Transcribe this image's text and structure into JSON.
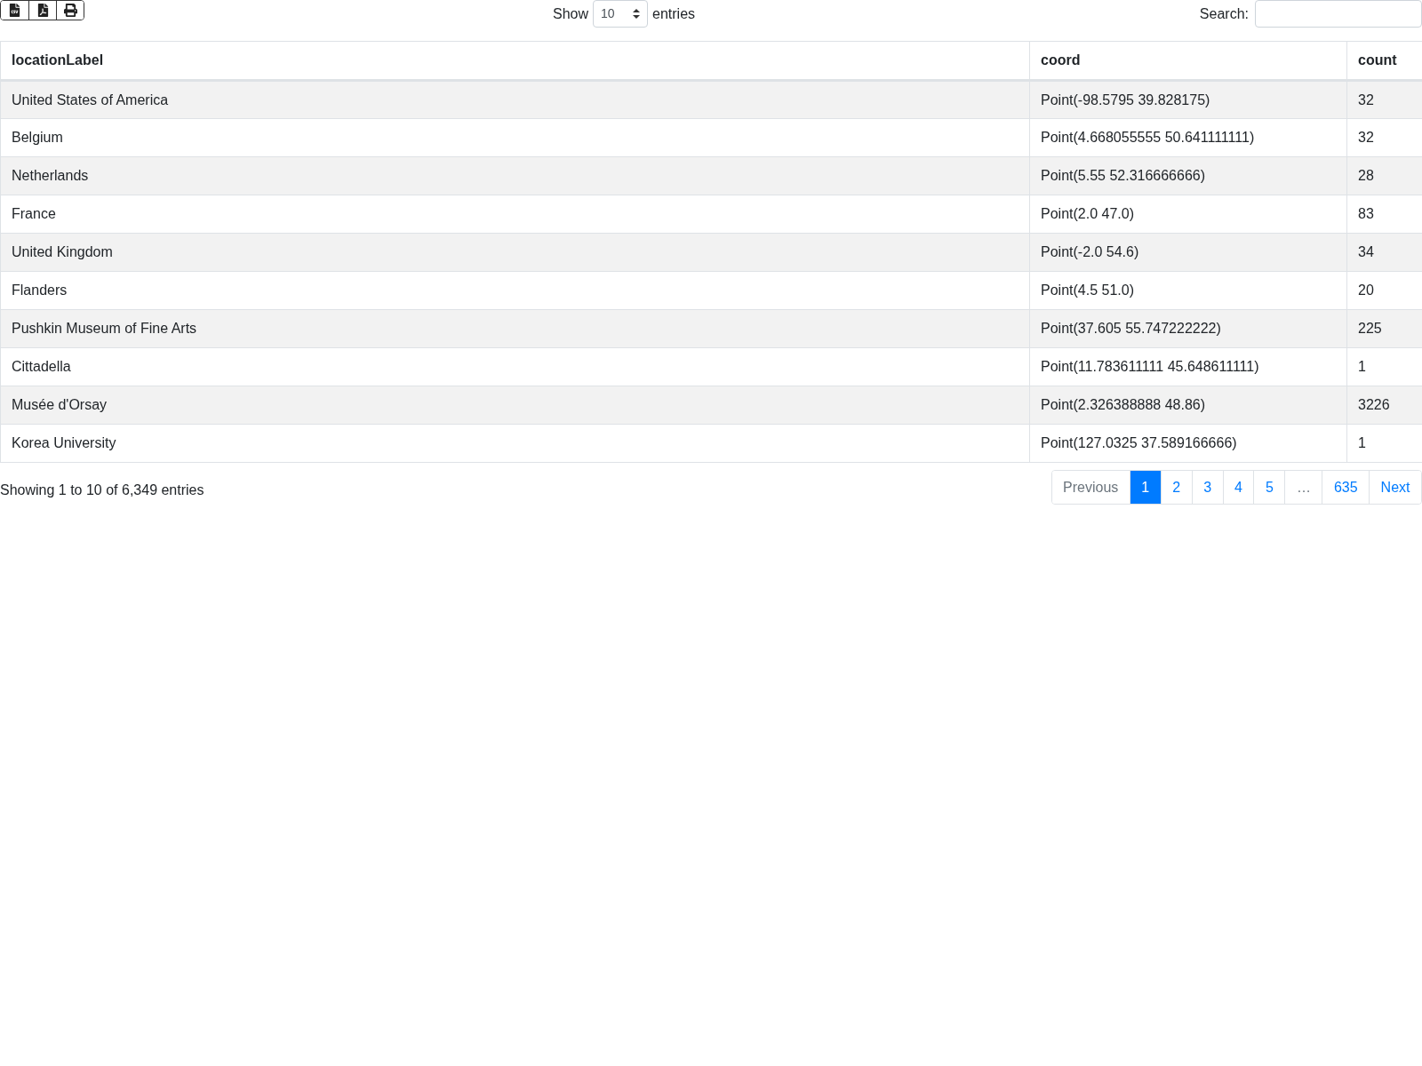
{
  "export_buttons": [
    {
      "kind": "csv"
    },
    {
      "kind": "pdf"
    },
    {
      "kind": "print"
    }
  ],
  "length": {
    "prefix": "Show",
    "value": "10",
    "suffix": "entries"
  },
  "search": {
    "label": "Search:"
  },
  "table": {
    "columns": [
      "locationLabel",
      "coord",
      "count"
    ],
    "rows": [
      [
        "United States of America",
        "Point(-98.5795 39.828175)",
        "32"
      ],
      [
        "Belgium",
        "Point(4.668055555 50.641111111)",
        "32"
      ],
      [
        "Netherlands",
        "Point(5.55 52.316666666)",
        "28"
      ],
      [
        "France",
        "Point(2.0 47.0)",
        "83"
      ],
      [
        "United Kingdom",
        "Point(-2.0 54.6)",
        "34"
      ],
      [
        "Flanders",
        "Point(4.5 51.0)",
        "20"
      ],
      [
        "Pushkin Museum of Fine Arts",
        "Point(37.605 55.747222222)",
        "225"
      ],
      [
        "Cittadella",
        "Point(11.783611111 45.648611111)",
        "1"
      ],
      [
        "Musée d'Orsay",
        "Point(2.326388888 48.86)",
        "3226"
      ],
      [
        "Korea University",
        "Point(127.0325 37.589166666)",
        "1"
      ]
    ]
  },
  "info": "Showing 1 to 10 of 6,349 entries",
  "pagination": [
    {
      "label": "Previous",
      "selected": false,
      "disabled": true
    },
    {
      "label": "1",
      "selected": true,
      "disabled": false
    },
    {
      "label": "2",
      "selected": false,
      "disabled": false
    },
    {
      "label": "3",
      "selected": false,
      "disabled": false
    },
    {
      "label": "4",
      "selected": false,
      "disabled": false
    },
    {
      "label": "5",
      "selected": false,
      "disabled": false
    },
    {
      "label": "…",
      "selected": false,
      "disabled": true
    },
    {
      "label": "635",
      "selected": false,
      "disabled": false
    },
    {
      "label": "Next",
      "selected": false,
      "disabled": false
    }
  ]
}
